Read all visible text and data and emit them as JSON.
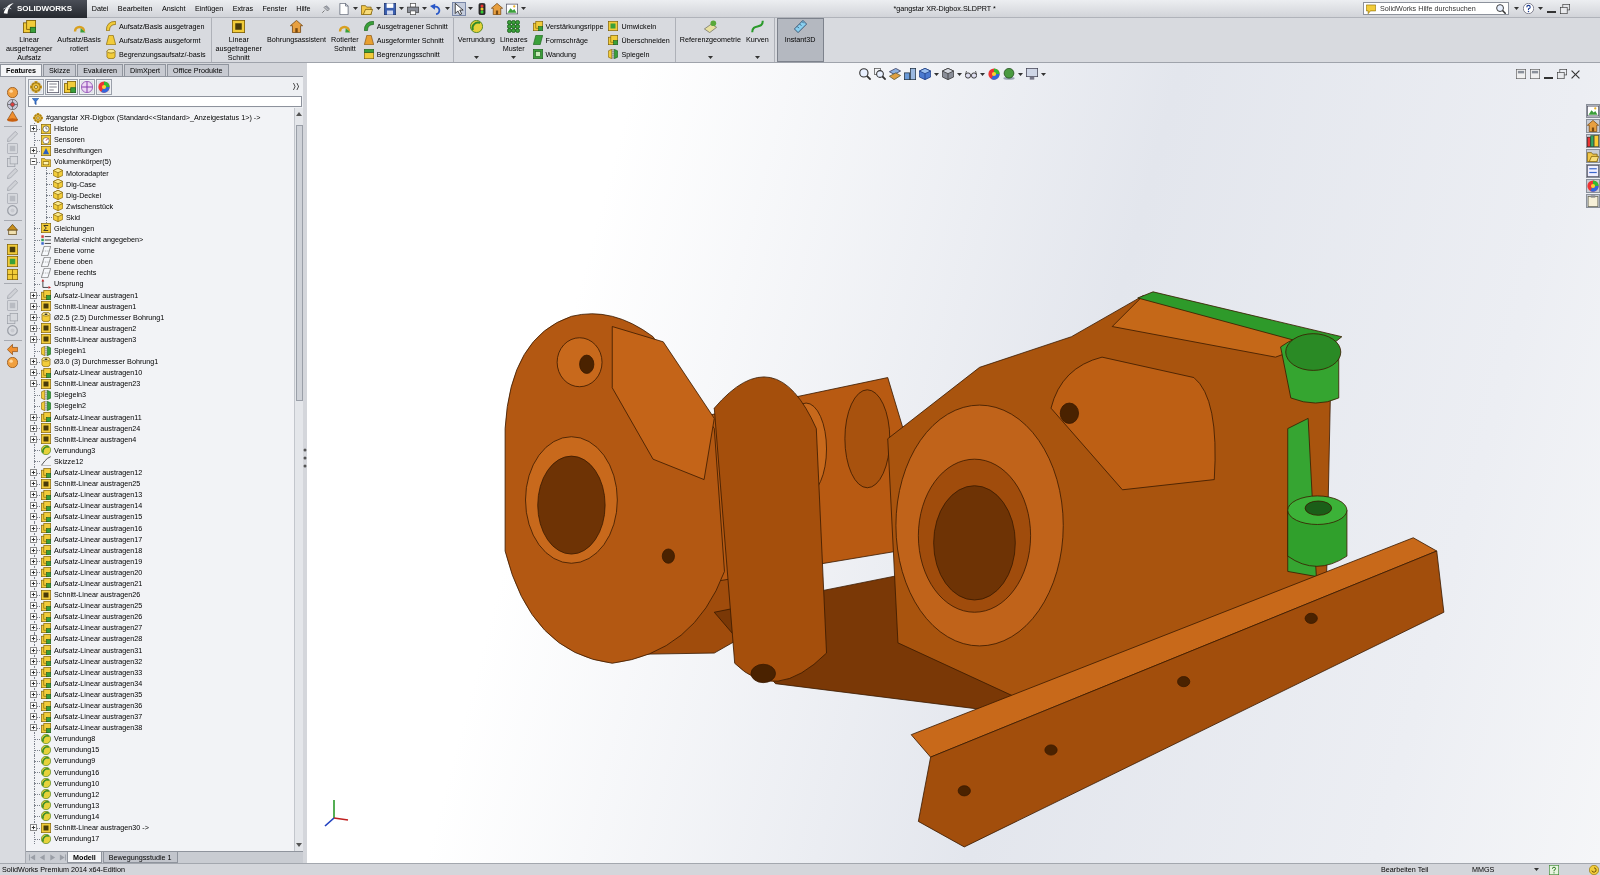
{
  "title_bar": {
    "logo": "SOLIDWORKS",
    "menu": [
      "Datei",
      "Bearbeiten",
      "Ansicht",
      "Einfügen",
      "Extras",
      "Fenster",
      "Hilfe"
    ],
    "document_title": "*gangstar XR-Digbox.SLDPRT *",
    "search": {
      "placeholder": "SolidWorks Hilfe durchsuchen"
    }
  },
  "quick_toolbar": {
    "select_active": true
  },
  "ribbon": [
    {
      "buttons": [
        {
          "kind": "large",
          "lines": [
            "Linear",
            "ausgetragener",
            "Aufsatz"
          ],
          "dropdown": false
        },
        {
          "kind": "large",
          "lines": [
            "Aufsatz/Basis",
            "rotiert"
          ],
          "dropdown": false
        },
        {
          "kind": "stack",
          "items": [
            "Aufsatz/Basis ausgetragen",
            "Aufsatz/Basis ausgeformt",
            "Begrenzungsaufsatz/-basis"
          ]
        }
      ]
    },
    {
      "buttons": [
        {
          "kind": "large",
          "lines": [
            "Linear",
            "ausgetragener",
            "Schnitt"
          ],
          "dropdown": false
        },
        {
          "kind": "large",
          "lines": [
            "Bohrungsassistent"
          ],
          "dropdown": false
        },
        {
          "kind": "large",
          "lines": [
            "Rotierter",
            "Schnitt"
          ],
          "dropdown": false
        },
        {
          "kind": "stack",
          "items": [
            "Ausgetragener Schnitt",
            "Ausgeformter Schnitt",
            "Begrenzungsschnitt"
          ]
        }
      ]
    },
    {
      "buttons": [
        {
          "kind": "large",
          "lines": [
            "Verrundung"
          ],
          "dropdown": true
        },
        {
          "kind": "large",
          "lines": [
            "Lineares",
            "Muster"
          ],
          "dropdown": true
        },
        {
          "kind": "stack",
          "items": [
            "Verstärkungsrippe",
            "Formschräge",
            "Wandung"
          ]
        },
        {
          "kind": "stack",
          "items": [
            "Umwickeln",
            "Überschneiden",
            "Spiegeln"
          ]
        }
      ]
    },
    {
      "buttons": [
        {
          "kind": "large",
          "lines": [
            "Referenzgeometrie"
          ],
          "dropdown": true
        },
        {
          "kind": "large",
          "lines": [
            "Kurven"
          ],
          "dropdown": true
        }
      ]
    },
    {
      "buttons": [
        {
          "kind": "toggle",
          "lines": [
            "Instant3D"
          ],
          "on": true
        }
      ]
    }
  ],
  "tabs": [
    {
      "label": "Features",
      "selected": true
    },
    {
      "label": "Skizze",
      "selected": false
    },
    {
      "label": "Evaluieren",
      "selected": false
    },
    {
      "label": "DimXpert",
      "selected": false
    },
    {
      "label": "Office Produkte",
      "selected": false
    }
  ],
  "feature_tree": {
    "root": {
      "kind": "part",
      "label": "#gangstar XR-Digbox (Standard<<Standard>_Anzeigestatus 1>) ->",
      "children": [
        {
          "kind": "history",
          "label": "Historie",
          "expanded": false
        },
        {
          "kind": "sensor",
          "label": "Sensoren"
        },
        {
          "kind": "annotation",
          "label": "Beschriftungen",
          "expanded": false
        },
        {
          "kind": "folder",
          "label": "Volumenkörper(5)",
          "expanded": true,
          "children": [
            {
              "kind": "body",
              "label": "Motoradapter"
            },
            {
              "kind": "body",
              "label": "Dig-Case"
            },
            {
              "kind": "body",
              "label": "Dig-Deckel"
            },
            {
              "kind": "body",
              "label": "Zwischenstück"
            },
            {
              "kind": "body",
              "label": "Skid"
            }
          ]
        },
        {
          "kind": "equations",
          "label": "Gleichungen"
        },
        {
          "kind": "material",
          "label": "Material <nicht angegeben>"
        },
        {
          "kind": "plane",
          "label": "Ebene vorne"
        },
        {
          "kind": "plane",
          "label": "Ebene oben"
        },
        {
          "kind": "plane",
          "label": "Ebene rechts"
        },
        {
          "kind": "origin",
          "label": "Ursprung"
        },
        {
          "kind": "boss",
          "label": "Aufsatz-Linear austragen1",
          "expanded": false
        },
        {
          "kind": "cut",
          "label": "Schnitt-Linear austragen1",
          "expanded": false
        },
        {
          "kind": "hole",
          "label": "Ø2.5 (2.5) Durchmesser Bohrung1",
          "expanded": false
        },
        {
          "kind": "cut",
          "label": "Schnitt-Linear austragen2",
          "expanded": false
        },
        {
          "kind": "cut",
          "label": "Schnitt-Linear austragen3",
          "expanded": false
        },
        {
          "kind": "mirror",
          "label": "Spiegeln1"
        },
        {
          "kind": "hole",
          "label": "Ø3.0 (3) Durchmesser Bohrung1",
          "expanded": false
        },
        {
          "kind": "boss",
          "label": "Aufsatz-Linear austragen10",
          "expanded": false
        },
        {
          "kind": "cut",
          "label": "Schnitt-Linear austragen23",
          "expanded": false
        },
        {
          "kind": "mirror",
          "label": "Spiegeln3"
        },
        {
          "kind": "mirror",
          "label": "Spiegeln2"
        },
        {
          "kind": "boss",
          "label": "Aufsatz-Linear austragen11",
          "expanded": false
        },
        {
          "kind": "cut",
          "label": "Schnitt-Linear austragen24",
          "expanded": false
        },
        {
          "kind": "cut",
          "label": "Schnitt-Linear austragen4",
          "expanded": false
        },
        {
          "kind": "fillet",
          "label": "Verrundung3"
        },
        {
          "kind": "sketch",
          "label": "Skizze12"
        },
        {
          "kind": "boss",
          "label": "Aufsatz-Linear austragen12",
          "expanded": false
        },
        {
          "kind": "cut",
          "label": "Schnitt-Linear austragen25",
          "expanded": false
        },
        {
          "kind": "boss",
          "label": "Aufsatz-Linear austragen13",
          "expanded": false
        },
        {
          "kind": "boss",
          "label": "Aufsatz-Linear austragen14",
          "expanded": false
        },
        {
          "kind": "boss",
          "label": "Aufsatz-Linear austragen15",
          "expanded": false
        },
        {
          "kind": "boss",
          "label": "Aufsatz-Linear austragen16",
          "expanded": false
        },
        {
          "kind": "boss",
          "label": "Aufsatz-Linear austragen17",
          "expanded": false
        },
        {
          "kind": "boss",
          "label": "Aufsatz-Linear austragen18",
          "expanded": false
        },
        {
          "kind": "boss",
          "label": "Aufsatz-Linear austragen19",
          "expanded": false
        },
        {
          "kind": "boss",
          "label": "Aufsatz-Linear austragen20",
          "expanded": false
        },
        {
          "kind": "boss",
          "label": "Aufsatz-Linear austragen21",
          "expanded": false
        },
        {
          "kind": "cut",
          "label": "Schnitt-Linear austragen26",
          "expanded": false
        },
        {
          "kind": "boss",
          "label": "Aufsatz-Linear austragen25",
          "expanded": false
        },
        {
          "kind": "boss",
          "label": "Aufsatz-Linear austragen26",
          "expanded": false
        },
        {
          "kind": "boss",
          "label": "Aufsatz-Linear austragen27",
          "expanded": false
        },
        {
          "kind": "boss",
          "label": "Aufsatz-Linear austragen28",
          "expanded": false
        },
        {
          "kind": "boss",
          "label": "Aufsatz-Linear austragen31",
          "expanded": false
        },
        {
          "kind": "boss",
          "label": "Aufsatz-Linear austragen32",
          "expanded": false
        },
        {
          "kind": "boss",
          "label": "Aufsatz-Linear austragen33",
          "expanded": false
        },
        {
          "kind": "boss",
          "label": "Aufsatz-Linear austragen34",
          "expanded": false
        },
        {
          "kind": "boss",
          "label": "Aufsatz-Linear austragen35",
          "expanded": false
        },
        {
          "kind": "boss",
          "label": "Aufsatz-Linear austragen36",
          "expanded": false
        },
        {
          "kind": "boss",
          "label": "Aufsatz-Linear austragen37",
          "expanded": false
        },
        {
          "kind": "boss",
          "label": "Aufsatz-Linear austragen38",
          "expanded": false
        },
        {
          "kind": "fillet",
          "label": "Verrundung8"
        },
        {
          "kind": "fillet",
          "label": "Verrundung15"
        },
        {
          "kind": "fillet",
          "label": "Verrundung9"
        },
        {
          "kind": "fillet",
          "label": "Verrundung16"
        },
        {
          "kind": "fillet",
          "label": "Verrundung10"
        },
        {
          "kind": "fillet",
          "label": "Verrundung12"
        },
        {
          "kind": "fillet",
          "label": "Verrundung13"
        },
        {
          "kind": "fillet",
          "label": "Verrundung14"
        },
        {
          "kind": "cut",
          "label": "Schnitt-Linear austragen30 ->",
          "expanded": false
        },
        {
          "kind": "fillet",
          "label": "Verrundung17"
        }
      ]
    }
  },
  "bottom_tabs": [
    {
      "label": "Modell",
      "selected": true
    },
    {
      "label": "Bewegungsstudie 1",
      "selected": false
    }
  ],
  "status_bar": {
    "product": "SolidWorks Premium 2014 x64-Edition",
    "mode": "Bearbeiten Teil",
    "units": "MMGS"
  }
}
